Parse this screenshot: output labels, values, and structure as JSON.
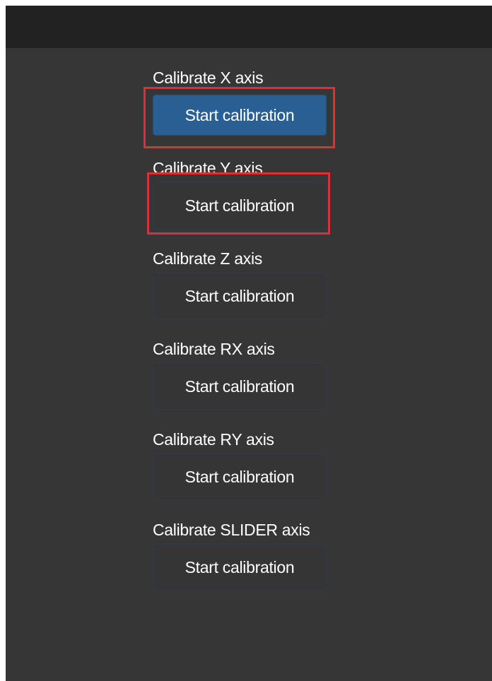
{
  "axes": [
    {
      "label": "Calibrate X axis",
      "button_label": "Start calibration",
      "active": true,
      "highlighted": true
    },
    {
      "label": "Calibrate Y axis",
      "button_label": "Start calibration",
      "active": false,
      "highlighted": true
    },
    {
      "label": "Calibrate Z axis",
      "button_label": "Start calibration",
      "active": false,
      "highlighted": false
    },
    {
      "label": "Calibrate RX axis",
      "button_label": "Start calibration",
      "active": false,
      "highlighted": false
    },
    {
      "label": "Calibrate RY axis",
      "button_label": "Start calibration",
      "active": false,
      "highlighted": false
    },
    {
      "label": "Calibrate SLIDER axis",
      "button_label": "Start calibration",
      "active": false,
      "highlighted": false
    }
  ],
  "colors": {
    "background": "#363636",
    "topbar": "#222222",
    "primary_button": "#2a5f93",
    "highlight_border": "#dc2f36"
  }
}
